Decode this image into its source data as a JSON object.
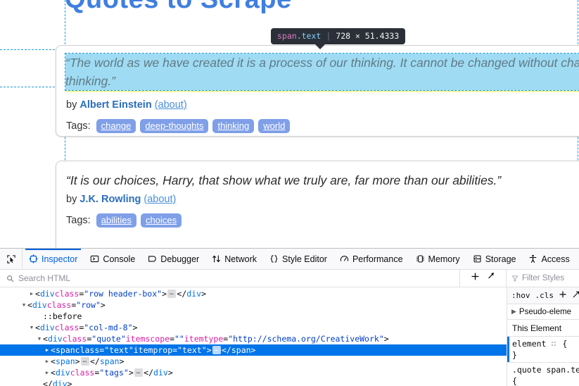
{
  "page": {
    "title": "Quotes to Scrape",
    "quotes": [
      {
        "text": "“The world as we have created it is a process of our thinking. It cannot be changed without changing our thinking.”",
        "by_label": "by",
        "author": "Albert Einstein",
        "about": "(about)",
        "tags_label": "Tags:",
        "tags": [
          "change",
          "deep-thoughts",
          "thinking",
          "world"
        ]
      },
      {
        "text": "“It is our choices, Harry, that show what we truly are, far more than our abilities.”",
        "by_label": "by",
        "author": "J.K. Rowling",
        "about": "(about)",
        "tags_label": "Tags:",
        "tags": [
          "abilities",
          "choices"
        ]
      }
    ]
  },
  "highlighter": {
    "tag": "span",
    "class": ".text",
    "separator": "|",
    "dimensions": "728 × 51.4333",
    "content_color": "#9fdbf3",
    "margin_color": "#f4f7a5",
    "guide_color": "#1a9bdb"
  },
  "devtools": {
    "accent": "#0060df",
    "tabs": [
      {
        "label": "Inspector",
        "icon": "inspector-icon",
        "active": true
      },
      {
        "label": "Console",
        "icon": "console-icon",
        "active": false
      },
      {
        "label": "Debugger",
        "icon": "debugger-icon",
        "active": false
      },
      {
        "label": "Network",
        "icon": "network-icon",
        "active": false
      },
      {
        "label": "Style Editor",
        "icon": "style-editor-icon",
        "active": false
      },
      {
        "label": "Performance",
        "icon": "performance-icon",
        "active": false
      },
      {
        "label": "Memory",
        "icon": "memory-icon",
        "active": false
      },
      {
        "label": "Storage",
        "icon": "storage-icon",
        "active": false
      },
      {
        "label": "Access",
        "icon": "accessibility-icon",
        "active": false
      }
    ],
    "search": {
      "placeholder": "Search HTML"
    },
    "filter": {
      "placeholder": "Filter Styles"
    },
    "markup": [
      {
        "indent": 2,
        "twisty": "collapsed",
        "selected": false,
        "tokens": [
          {
            "t": "punct",
            "v": "<"
          },
          {
            "t": "tag",
            "v": "div"
          },
          {
            "t": "sp",
            "v": " "
          },
          {
            "t": "attr",
            "v": "class"
          },
          {
            "t": "punct",
            "v": "="
          },
          {
            "t": "val",
            "v": "\"row header-box\""
          },
          {
            "t": "punct",
            "v": ">"
          },
          {
            "t": "ellip",
            "v": ""
          },
          {
            "t": "punct",
            "v": "</"
          },
          {
            "t": "tag",
            "v": "div"
          },
          {
            "t": "punct",
            "v": ">"
          }
        ]
      },
      {
        "indent": 1,
        "twisty": "expanded",
        "selected": false,
        "tokens": [
          {
            "t": "punct",
            "v": "<"
          },
          {
            "t": "tag",
            "v": "div"
          },
          {
            "t": "sp",
            "v": " "
          },
          {
            "t": "attr",
            "v": "class"
          },
          {
            "t": "punct",
            "v": "="
          },
          {
            "t": "val",
            "v": "\"row\""
          },
          {
            "t": "punct",
            "v": ">"
          }
        ]
      },
      {
        "indent": 3,
        "twisty": "none",
        "selected": false,
        "tokens": [
          {
            "t": "pseudo",
            "v": "::before"
          }
        ]
      },
      {
        "indent": 2,
        "twisty": "expanded",
        "selected": false,
        "tokens": [
          {
            "t": "punct",
            "v": "<"
          },
          {
            "t": "tag",
            "v": "div"
          },
          {
            "t": "sp",
            "v": " "
          },
          {
            "t": "attr",
            "v": "class"
          },
          {
            "t": "punct",
            "v": "="
          },
          {
            "t": "val",
            "v": "\"col-md-8\""
          },
          {
            "t": "punct",
            "v": ">"
          }
        ]
      },
      {
        "indent": 3,
        "twisty": "expanded",
        "selected": false,
        "tokens": [
          {
            "t": "punct",
            "v": "<"
          },
          {
            "t": "tag",
            "v": "div"
          },
          {
            "t": "sp",
            "v": " "
          },
          {
            "t": "attr",
            "v": "class"
          },
          {
            "t": "punct",
            "v": "="
          },
          {
            "t": "val",
            "v": "\"quote\""
          },
          {
            "t": "sp",
            "v": " "
          },
          {
            "t": "attr",
            "v": "itemscope"
          },
          {
            "t": "punct",
            "v": "="
          },
          {
            "t": "val",
            "v": "\"\""
          },
          {
            "t": "sp",
            "v": " "
          },
          {
            "t": "attr",
            "v": "itemtype"
          },
          {
            "t": "punct",
            "v": "="
          },
          {
            "t": "val",
            "v": "\"http://schema.org/CreativeWork\""
          },
          {
            "t": "punct",
            "v": ">"
          }
        ]
      },
      {
        "indent": 4,
        "twisty": "collapsed",
        "selected": true,
        "tokens": [
          {
            "t": "punct",
            "v": "<"
          },
          {
            "t": "tag",
            "v": "span"
          },
          {
            "t": "sp",
            "v": " "
          },
          {
            "t": "attr",
            "v": "class"
          },
          {
            "t": "punct",
            "v": "="
          },
          {
            "t": "val",
            "v": "\"text\""
          },
          {
            "t": "sp",
            "v": " "
          },
          {
            "t": "attr",
            "v": "itemprop"
          },
          {
            "t": "punct",
            "v": "="
          },
          {
            "t": "val",
            "v": "\"text\""
          },
          {
            "t": "punct",
            "v": ">"
          },
          {
            "t": "ellip",
            "v": ""
          },
          {
            "t": "punct",
            "v": "</"
          },
          {
            "t": "tag",
            "v": "span"
          },
          {
            "t": "punct",
            "v": ">"
          }
        ]
      },
      {
        "indent": 4,
        "twisty": "collapsed",
        "selected": false,
        "tokens": [
          {
            "t": "punct",
            "v": "<"
          },
          {
            "t": "tag",
            "v": "span"
          },
          {
            "t": "punct",
            "v": ">"
          },
          {
            "t": "ellip",
            "v": ""
          },
          {
            "t": "punct",
            "v": "</"
          },
          {
            "t": "tag",
            "v": "span"
          },
          {
            "t": "punct",
            "v": ">"
          }
        ]
      },
      {
        "indent": 4,
        "twisty": "collapsed",
        "selected": false,
        "tokens": [
          {
            "t": "punct",
            "v": "<"
          },
          {
            "t": "tag",
            "v": "div"
          },
          {
            "t": "sp",
            "v": " "
          },
          {
            "t": "attr",
            "v": "class"
          },
          {
            "t": "punct",
            "v": "="
          },
          {
            "t": "val",
            "v": "\"tags\""
          },
          {
            "t": "punct",
            "v": ">"
          },
          {
            "t": "ellip",
            "v": ""
          },
          {
            "t": "punct",
            "v": "</"
          },
          {
            "t": "tag",
            "v": "div"
          },
          {
            "t": "punct",
            "v": ">"
          }
        ]
      },
      {
        "indent": 3,
        "twisty": "none",
        "selected": false,
        "tokens": [
          {
            "t": "punct",
            "v": "</"
          },
          {
            "t": "tag",
            "v": "div"
          },
          {
            "t": "punct",
            "v": ">"
          }
        ]
      }
    ],
    "rules_panel": {
      "hov": ":hov",
      "cls": ".cls",
      "add_rule": "+",
      "pseudo_elements": "Pseudo-eleme",
      "this_element": "This Element",
      "rules": [
        {
          "selector": "element",
          "has_grid_icon": true,
          "open": "{",
          "close": "}",
          "selected": true
        },
        {
          "selector": ".quote span.te",
          "has_grid_icon": false,
          "open": "{",
          "close": "",
          "selected": false
        }
      ]
    }
  }
}
